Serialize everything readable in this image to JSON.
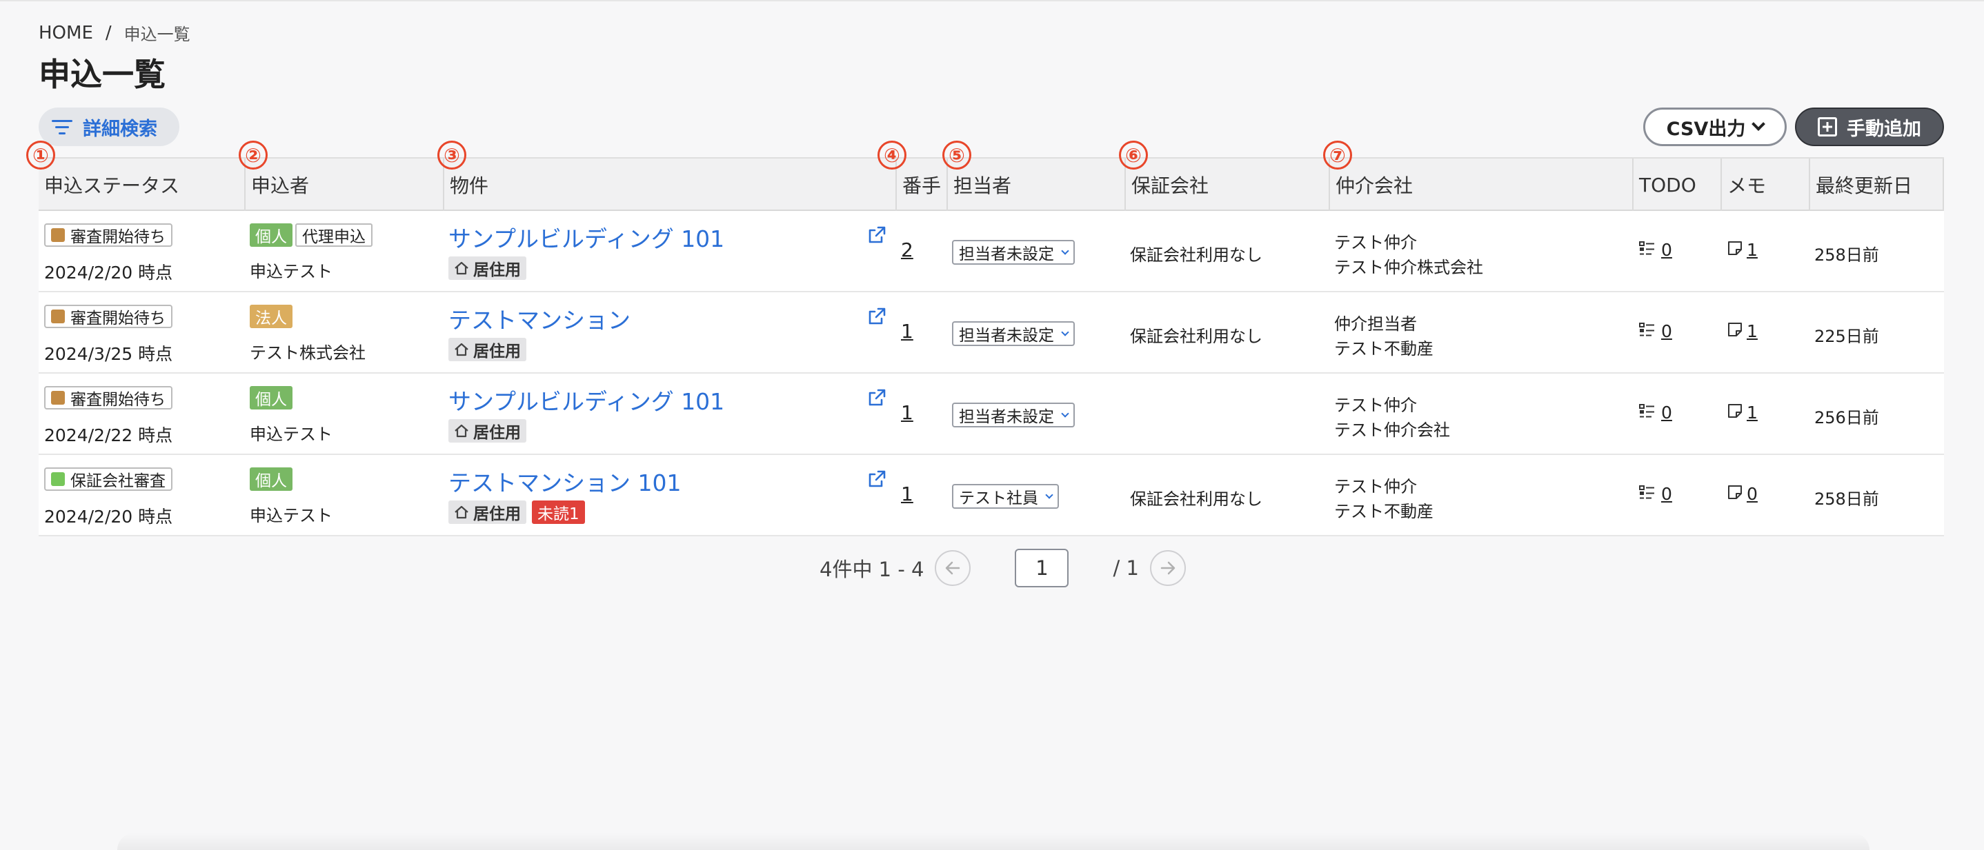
{
  "breadcrumb": {
    "home": "HOME",
    "separator": "/",
    "current": "申込一覧"
  },
  "title": "申込一覧",
  "toolbar": {
    "filter_label": "詳細検索",
    "csv_label": "CSV出力",
    "add_label": "手動追加"
  },
  "annotations": [
    "①",
    "②",
    "③",
    "④",
    "⑤",
    "⑥",
    "⑦"
  ],
  "columns": [
    "申込ステータス",
    "申込者",
    "物件",
    "番手",
    "担当者",
    "保証会社",
    "仲介会社",
    "TODO",
    "メモ",
    "最終更新日"
  ],
  "colors": {
    "accent": "#2b6fd6",
    "status_wait": "#c28a43",
    "status_guarantee": "#76c65a",
    "kojin": "#79b864",
    "hojin": "#dbad5e",
    "unread": "#e0413a",
    "annotation": "#e8462a"
  },
  "rows": [
    {
      "status": "審査開始待ち",
      "status_color": "#c28a43",
      "date": "2024/2/20 時点",
      "applicant_type": "個人",
      "applicant_type_kind": "kojin",
      "proxy": "代理申込",
      "applicant_name": "申込テスト",
      "property": "サンプルビルディング 101",
      "usage": "居住用",
      "unread": "",
      "number": "2",
      "assignee": "担当者未設定",
      "guarantor": "保証会社利用なし",
      "broker_line1": "テスト仲介",
      "broker_line2": "テスト仲介株式会社",
      "todo": "0",
      "memo": "1",
      "updated": "258日前"
    },
    {
      "status": "審査開始待ち",
      "status_color": "#c28a43",
      "date": "2024/3/25 時点",
      "applicant_type": "法人",
      "applicant_type_kind": "hojin",
      "proxy": "",
      "applicant_name": "テスト株式会社",
      "property": "テストマンション",
      "usage": "居住用",
      "unread": "",
      "number": "1",
      "assignee": "担当者未設定",
      "guarantor": "保証会社利用なし",
      "broker_line1": "仲介担当者",
      "broker_line2": "テスト不動産",
      "todo": "0",
      "memo": "1",
      "updated": "225日前"
    },
    {
      "status": "審査開始待ち",
      "status_color": "#c28a43",
      "date": "2024/2/22 時点",
      "applicant_type": "個人",
      "applicant_type_kind": "kojin",
      "proxy": "",
      "applicant_name": "申込テスト",
      "property": "サンプルビルディング 101",
      "usage": "居住用",
      "unread": "",
      "number": "1",
      "assignee": "担当者未設定",
      "guarantor": "",
      "broker_line1": "テスト仲介",
      "broker_line2": "テスト仲介会社",
      "todo": "0",
      "memo": "1",
      "updated": "256日前"
    },
    {
      "status": "保証会社審査",
      "status_color": "#76c65a",
      "date": "2024/2/20 時点",
      "applicant_type": "個人",
      "applicant_type_kind": "kojin",
      "proxy": "",
      "applicant_name": "申込テスト",
      "property": "テストマンション 101",
      "usage": "居住用",
      "unread": "未読1",
      "number": "1",
      "assignee": "テスト社員",
      "guarantor": "保証会社利用なし",
      "broker_line1": "テスト仲介",
      "broker_line2": "テスト不動産",
      "todo": "0",
      "memo": "0",
      "updated": "258日前"
    }
  ],
  "pagination": {
    "summary": "4件中 1 - 4",
    "prev_icon": "arrow-left-icon",
    "current": "1",
    "total": "/ 1",
    "next_icon": "arrow-right-icon"
  }
}
